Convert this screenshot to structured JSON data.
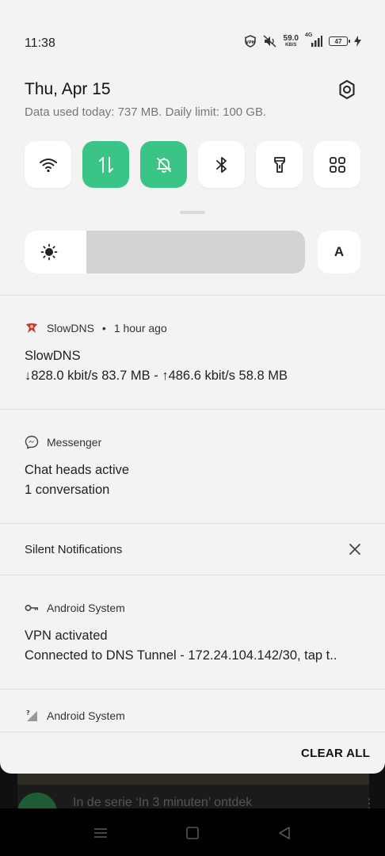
{
  "status_bar": {
    "time": "11:38",
    "icons": [
      "vpn-icon",
      "mute-icon",
      "signal-icon"
    ],
    "net_speed_value": "59.0",
    "net_speed_unit": "KB/S",
    "network_type": "4G",
    "battery_level": "47"
  },
  "header": {
    "date": "Thu, Apr 15",
    "data_usage": "Data used today: 737 MB. Daily limit: 100 GB."
  },
  "quick_tiles": [
    {
      "name": "wifi",
      "icon": "wifi-icon",
      "active": false
    },
    {
      "name": "mobile-data",
      "icon": "data-transfer-icon",
      "active": true
    },
    {
      "name": "silent",
      "icon": "bell-off-icon",
      "active": true
    },
    {
      "name": "bluetooth",
      "icon": "bluetooth-icon",
      "active": false
    },
    {
      "name": "flashlight",
      "icon": "flashlight-icon",
      "active": false
    },
    {
      "name": "more",
      "icon": "grid-icon",
      "active": false
    }
  ],
  "brightness": {
    "level_percent": 22,
    "auto_label": "A"
  },
  "notifications": [
    {
      "app": "SlowDNS",
      "time": "1 hour ago",
      "title": "SlowDNS",
      "text": "↓828.0 kbit/s 83.7 MB - ↑486.6 kbit/s 58.8 MB"
    },
    {
      "app": "Messenger",
      "title": "Chat heads active",
      "text": "1 conversation"
    }
  ],
  "silent_section": {
    "label": "Silent Notifications"
  },
  "silent_notifications": [
    {
      "app": "Android System",
      "title": "VPN activated",
      "text": "Connected to DNS Tunnel - 172.24.104.142/30, tap t.."
    },
    {
      "app": "Android System"
    }
  ],
  "clear_all_label": "CLEAR ALL",
  "background_notification": {
    "text": "In de serie ‘In 3 minuten’ ontdek",
    "more": "⋮"
  },
  "colors": {
    "accent": "#3ac488",
    "panel": "#f3f3f3",
    "tile": "#ffffff"
  }
}
